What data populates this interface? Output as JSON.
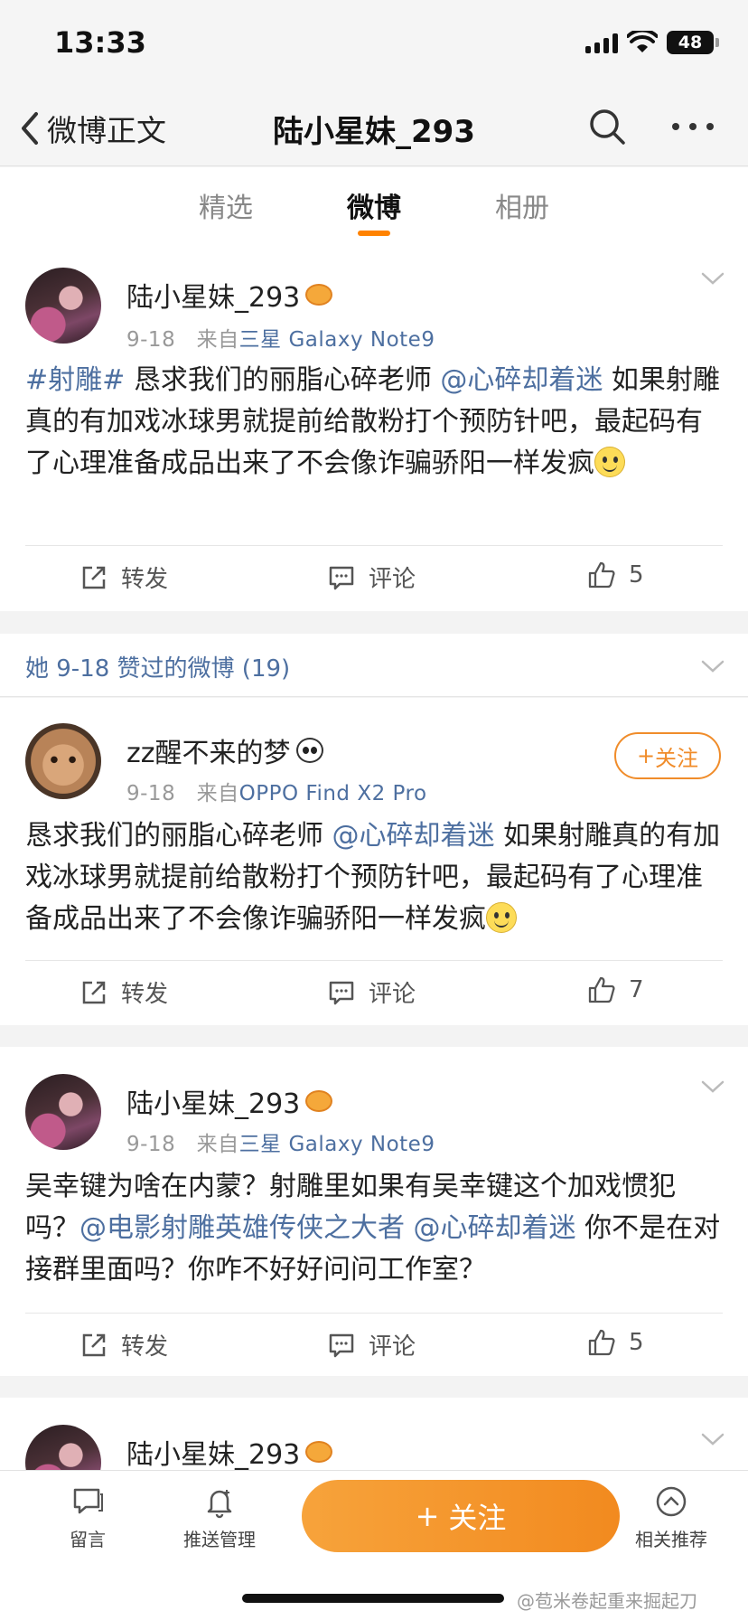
{
  "status": {
    "time": "13:33",
    "battery": "48"
  },
  "nav": {
    "back_label": "微博正文",
    "title": "陆小星妹_293"
  },
  "tabs": [
    {
      "label": "精选"
    },
    {
      "label": "微博"
    },
    {
      "label": "相册"
    }
  ],
  "posts": [
    {
      "user": "陆小星妹_293",
      "date": "9-18",
      "from": "来自",
      "source": "三星 Galaxy Note9",
      "text": {
        "hashtag": "#射雕#",
        "t1": " 恳求我们的丽脂心碎老师 ",
        "mention1": "@心碎却着迷",
        "t2": " 如果射雕真的有加戏冰球男就提前给散粉打个预防针吧，最起码有了心理准备成品出来了不会像诈骗骄阳一样发疯"
      },
      "repost": "转发",
      "comment": "评论",
      "likes": "5"
    },
    {
      "user": "zz醒不来的梦",
      "date": "9-18",
      "from": "来自",
      "source": "OPPO Find X2 Pro",
      "follow": "关注",
      "text": {
        "t1": "恳求我们的丽脂心碎老师 ",
        "mention1": "@心碎却着迷",
        "t2": " 如果射雕真的有加戏冰球男就提前给散粉打个预防针吧，最起码有了心理准备成品出来了不会像诈骗骄阳一样发疯"
      },
      "repost": "转发",
      "comment": "评论",
      "likes": "7"
    },
    {
      "user": "陆小星妹_293",
      "date": "9-18",
      "from": "来自",
      "source": "三星 Galaxy Note9",
      "text": {
        "t1": "吴幸键为啥在内蒙？射雕里如果有吴幸键这个加戏惯犯   吗？",
        "mention1": "@电影射雕英雄传侠之大者",
        "mention2": "@心碎却着迷",
        "t2": " 你不是在对接群里面吗？你咋不好好问问工作室？"
      },
      "repost": "转发",
      "comment": "评论",
      "likes": "5"
    },
    {
      "user": "陆小星妹_293"
    }
  ],
  "liked_header": "她 9-18 赞过的微博 (19)",
  "bottom": {
    "message": "留言",
    "push": "推送管理",
    "follow": "关注",
    "related": "相关推荐",
    "watermark": "@苞米卷起重来掘起刀"
  },
  "colors": {
    "accent": "#ff8200",
    "link": "#4d6fa0",
    "follow_gradient_start": "#f7a33b",
    "follow_gradient_end": "#f28a1f"
  }
}
